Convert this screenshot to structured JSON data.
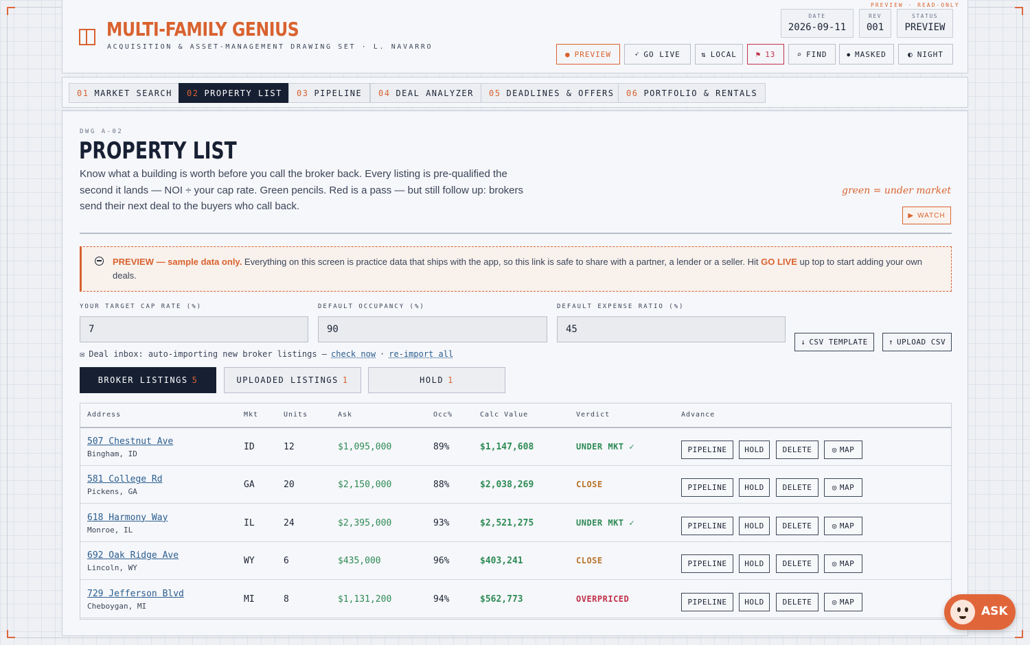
{
  "preview_tag": "PREVIEW · READ-ONLY",
  "app": {
    "title": "MULTI-FAMILY GENIUS",
    "subtitle": "ACQUISITION & ASSET-MANAGEMENT DRAWING SET · L. NAVARRO"
  },
  "meta": {
    "date_label": "DATE",
    "date": "2026-09-11",
    "rev_label": "REV",
    "rev": "001",
    "status_label": "STATUS",
    "status": "PREVIEW"
  },
  "header_buttons": {
    "preview": "PREVIEW",
    "go_live": "GO LIVE",
    "local": "LOCAL",
    "flags": "13",
    "find": "FIND",
    "masked": "MASKED",
    "night": "NIGHT"
  },
  "tabs": [
    {
      "num": "01",
      "label": "MARKET SEARCH"
    },
    {
      "num": "02",
      "label": "PROPERTY LIST"
    },
    {
      "num": "03",
      "label": "PIPELINE"
    },
    {
      "num": "04",
      "label": "DEAL ANALYZER"
    },
    {
      "num": "05",
      "label": "DEADLINES & OFFERS"
    },
    {
      "num": "06",
      "label": "PORTFOLIO & RENTALS"
    }
  ],
  "page": {
    "dwg": "DWG A-02",
    "title": "PROPERTY LIST",
    "intro": "Know what a building is worth before you call the broker back. Every listing is pre-qualified the second it lands — NOI ÷ your cap rate. Green pencils. Red is a pass — but still follow up: brokers send their next deal to the buyers who call back.",
    "hint": "green = under market",
    "watch": "WATCH"
  },
  "notice": {
    "lead": "PREVIEW — sample data only.",
    "text1": " Everything on this screen is practice data that ships with the app, so this link is safe to share with a partner, a lender or a seller. Hit ",
    "go_live": "GO LIVE",
    "text2": " up top to start adding your own deals."
  },
  "fields": {
    "cap_label": "YOUR TARGET CAP RATE (%)",
    "cap_value": "7",
    "occ_label": "DEFAULT OCCUPANCY (%)",
    "occ_value": "90",
    "exp_label": "DEFAULT EXPENSE RATIO (%)",
    "exp_value": "45"
  },
  "csv": {
    "template": "CSV TEMPLATE",
    "upload": "UPLOAD CSV"
  },
  "inbox": {
    "text": "Deal inbox: auto-importing new broker listings —",
    "check_now": "check now",
    "sep": "·",
    "reimport": "re-import all"
  },
  "subtabs": [
    {
      "label": "BROKER LISTINGS",
      "count": "5"
    },
    {
      "label": "UPLOADED LISTINGS",
      "count": "1"
    },
    {
      "label": "HOLD",
      "count": "1"
    }
  ],
  "table": {
    "headers": [
      "Address",
      "Mkt",
      "Units",
      "Ask",
      "Occ%",
      "Calc Value",
      "Verdict",
      "Advance"
    ],
    "actions": {
      "pipeline": "PIPELINE",
      "hold": "HOLD",
      "delete": "DELETE",
      "map": "MAP"
    },
    "rows": [
      {
        "address": "507 Chestnut Ave",
        "city": "Bingham, ID",
        "mkt": "ID",
        "units": "12",
        "ask": "$1,095,000",
        "occ": "89%",
        "calc": "$1,147,608",
        "verdict": "UNDER MKT ✓",
        "vclass": "v-under"
      },
      {
        "address": "581 College Rd",
        "city": "Pickens, GA",
        "mkt": "GA",
        "units": "20",
        "ask": "$2,150,000",
        "occ": "88%",
        "calc": "$2,038,269",
        "verdict": "CLOSE",
        "vclass": "v-close"
      },
      {
        "address": "618 Harmony Way",
        "city": "Monroe, IL",
        "mkt": "IL",
        "units": "24",
        "ask": "$2,395,000",
        "occ": "93%",
        "calc": "$2,521,275",
        "verdict": "UNDER MKT ✓",
        "vclass": "v-under"
      },
      {
        "address": "692 Oak Ridge Ave",
        "city": "Lincoln, WY",
        "mkt": "WY",
        "units": "6",
        "ask": "$435,000",
        "occ": "96%",
        "calc": "$403,241",
        "verdict": "CLOSE",
        "vclass": "v-close"
      },
      {
        "address": "729 Jefferson Blvd",
        "city": "Cheboygan, MI",
        "mkt": "MI",
        "units": "8",
        "ask": "$1,131,200",
        "occ": "94%",
        "calc": "$562,773",
        "verdict": "OVERPRICED",
        "vclass": "v-over"
      }
    ]
  },
  "ask": "ASK",
  "colors": {
    "accent": "#d9622f",
    "navy": "#172033",
    "green": "#2d8a55",
    "red": "#c0304a",
    "amber": "#b8722a"
  }
}
